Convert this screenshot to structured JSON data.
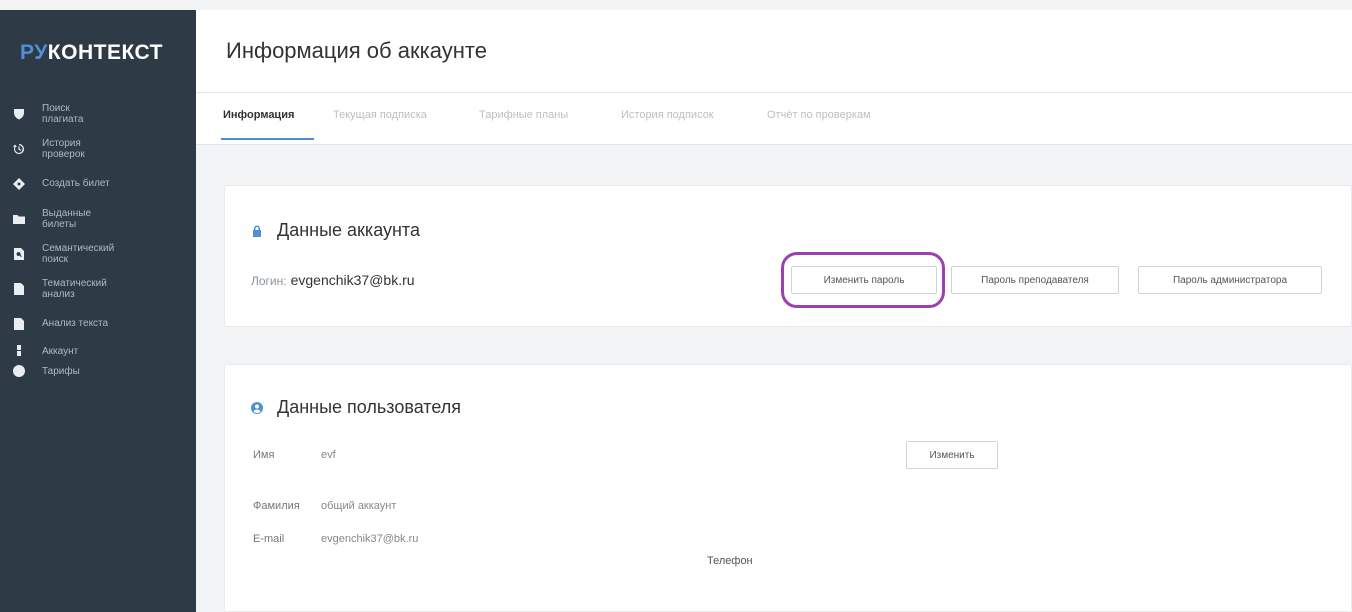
{
  "brand": {
    "part1": "РУ",
    "part2": "КОНТЕКСТ",
    "accent_color": "#4f8fd6"
  },
  "sidebar": {
    "items": [
      {
        "label": "Поиск плагиата",
        "icon": "shield-icon"
      },
      {
        "label": "История проверок",
        "icon": "history-icon"
      },
      {
        "label": "Создать билет",
        "icon": "ticket-icon"
      },
      {
        "label": "Выданные билеты",
        "icon": "folder-icon"
      },
      {
        "label": "Семантический поиск",
        "icon": "document-search-icon"
      },
      {
        "label": "Тематический анализ",
        "icon": "document-icon"
      },
      {
        "label": "Анализ текста",
        "icon": "file-icon"
      },
      {
        "label": "Аккаунт",
        "icon": "user-icon"
      },
      {
        "label": "Тарифы",
        "icon": "info-icon"
      }
    ]
  },
  "header": {
    "title": "Информация об аккаунте"
  },
  "tabs": [
    {
      "label": "Информация",
      "active": true
    },
    {
      "label": "Текущая подписка",
      "active": false
    },
    {
      "label": "Тарифные планы",
      "active": false
    },
    {
      "label": "История подписок",
      "active": false
    },
    {
      "label": "Отчёт по проверкам",
      "active": false
    }
  ],
  "account_card": {
    "title": "Данные аккаунта",
    "login_label": "Логин:",
    "login_value": "evgenchik37@bk.ru",
    "buttons": {
      "change_password": "Изменить пароль",
      "teacher_password": "Пароль преподавателя",
      "admin_password": "Пароль администратора"
    }
  },
  "user_card": {
    "title": "Данные пользователя",
    "edit_button": "Изменить",
    "fields": [
      {
        "label": "Имя",
        "value": "evf"
      },
      {
        "label": "Фамилия",
        "value": "общий аккаунт"
      },
      {
        "label": "E-mail",
        "value": "evgenchik37@bk.ru"
      }
    ],
    "phone_label": "Телефон"
  },
  "colors": {
    "sidebar_bg": "#2e3a45",
    "highlight": "#9b3fb3"
  }
}
